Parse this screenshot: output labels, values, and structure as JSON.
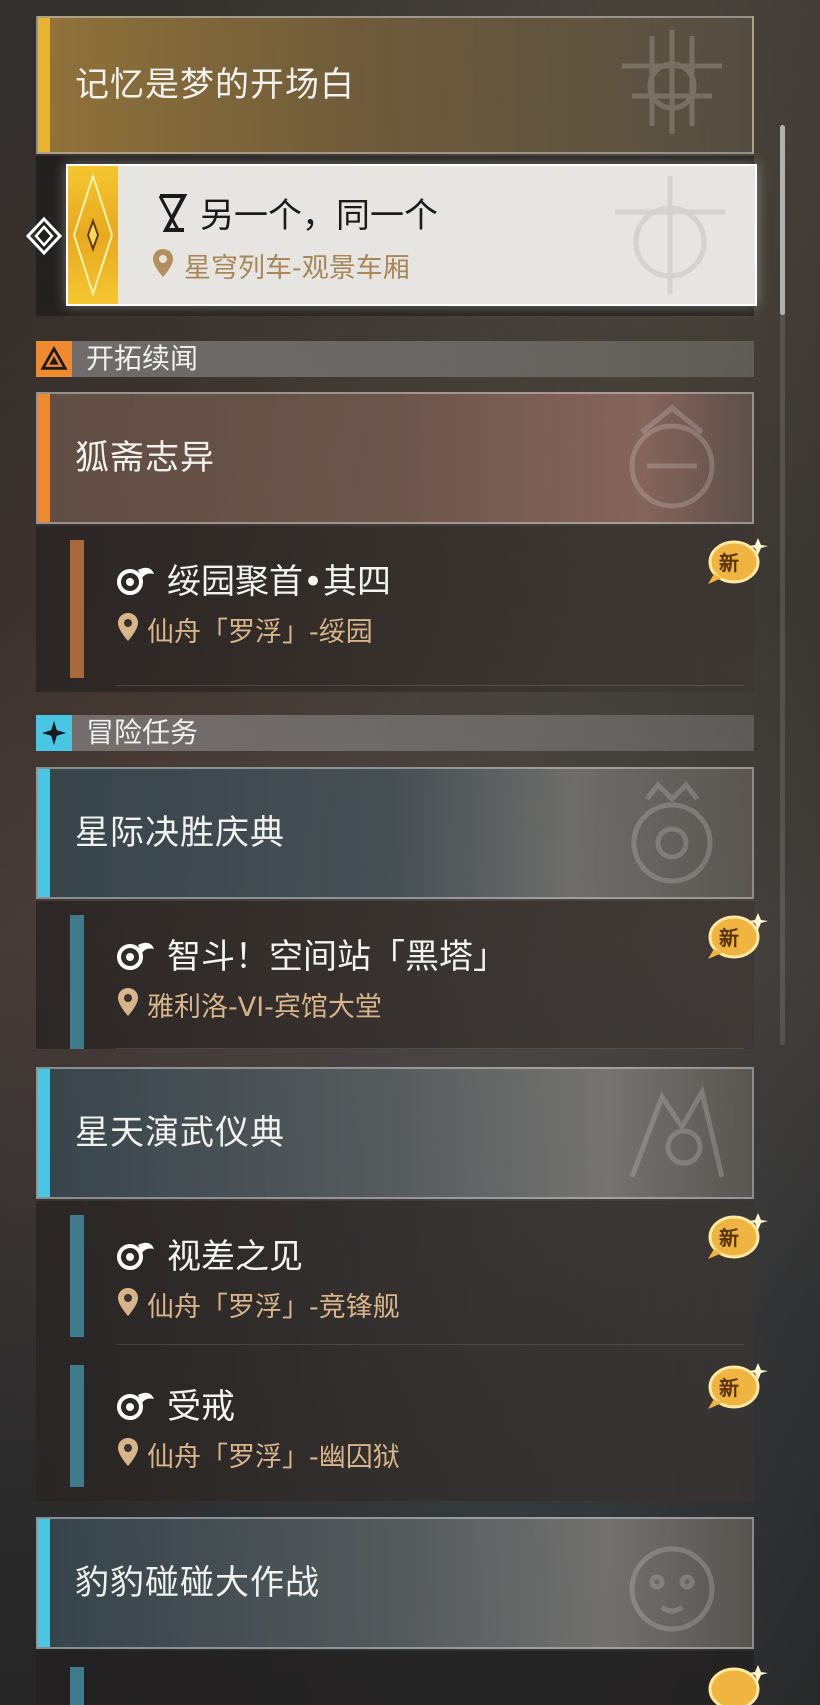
{
  "colors": {
    "main_quest": "#e8b430",
    "companion": "#f08a2e",
    "adventure": "#48c6e4",
    "location": "#d8b48a"
  },
  "current_quest": {
    "title": "记忆是梦的开场白",
    "sub": {
      "icon": "hourglass-icon",
      "title": "另一个，同一个",
      "location": "星穹列车-观景车厢"
    }
  },
  "sections": [
    {
      "label": "开拓续闻",
      "icon": "triangle-emblem-icon",
      "quests": [
        {
          "title": "狐斋志异",
          "subs": [
            {
              "title": "绥园聚首•其四",
              "location": "仙舟「罗浮」-绥园",
              "badge": "新"
            }
          ]
        }
      ]
    },
    {
      "label": "冒险任务",
      "icon": "four-point-star-icon",
      "quests": [
        {
          "title": "星际决胜庆典",
          "subs": [
            {
              "title": "智斗！空间站「黑塔」",
              "location": "雅利洛-VI-宾馆大堂",
              "badge": "新"
            }
          ]
        },
        {
          "title": "星天演武仪典",
          "subs": [
            {
              "title": "视差之见",
              "location": "仙舟「罗浮」-竞锋舰",
              "badge": "新"
            },
            {
              "title": "受戒",
              "location": "仙舟「罗浮」-幽囚狱",
              "badge": "新"
            }
          ]
        },
        {
          "title": "豹豹碰碰大作战",
          "subs": []
        }
      ]
    }
  ],
  "icons": {
    "location": "map-pin-icon",
    "quest_type": "adventure-quest-icon",
    "new_badge": "new-badge-icon",
    "tracker": "diamond-tracker-icon"
  }
}
